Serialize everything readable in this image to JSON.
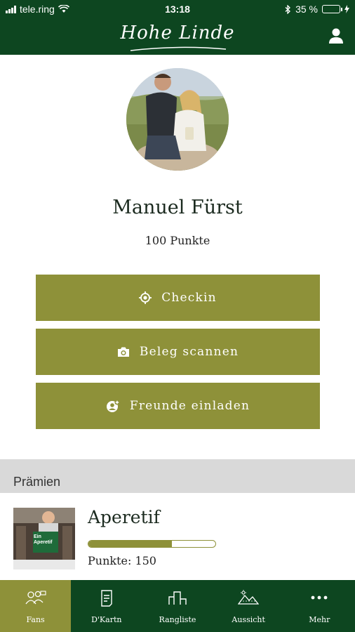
{
  "status_bar": {
    "carrier": "tele.ring",
    "time": "13:18",
    "battery": "35 %",
    "battery_level": 0.35
  },
  "header": {
    "brand": "Hohe Linde",
    "profile_icon": "user-icon"
  },
  "profile": {
    "name": "Manuel Fürst",
    "points": "100 Punkte"
  },
  "actions": [
    {
      "label": "Checkin",
      "icon": "target-icon"
    },
    {
      "label": "Beleg scannen",
      "icon": "camera-icon"
    },
    {
      "label": "Freunde einladen",
      "icon": "add-friend-icon"
    }
  ],
  "rewards": {
    "heading": "Prämien",
    "items": [
      {
        "title": "Aperetif",
        "points": "Punkte: 150",
        "progress": 0.66,
        "image_sign": "Ein Aperetif"
      }
    ]
  },
  "tabs": [
    {
      "label": "Fans",
      "icon": "fans-icon",
      "active": true
    },
    {
      "label": "D'Kartn",
      "icon": "card-icon",
      "active": false
    },
    {
      "label": "Rangliste",
      "icon": "ranking-icon",
      "active": false
    },
    {
      "label": "Aussicht",
      "icon": "view-icon",
      "active": false
    },
    {
      "label": "Mehr",
      "icon": "more-icon",
      "active": false
    }
  ],
  "colors": {
    "primary": "#0d4620",
    "accent": "#8e9139",
    "section_bg": "#d9d9d9"
  }
}
